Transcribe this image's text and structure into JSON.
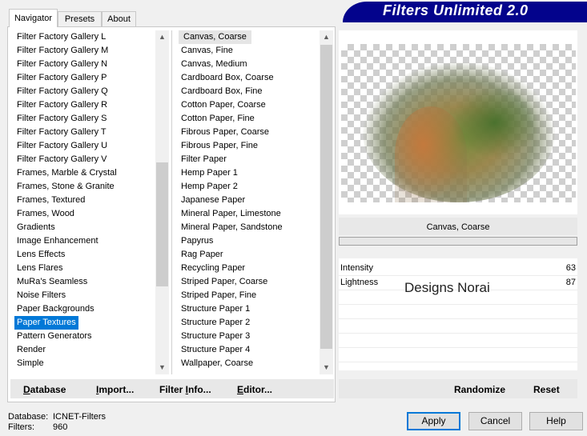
{
  "app": {
    "title": "Filters Unlimited 2.0"
  },
  "tabs": [
    {
      "label": "Navigator",
      "active": true
    },
    {
      "label": "Presets",
      "active": false
    },
    {
      "label": "About",
      "active": false
    }
  ],
  "categories": {
    "items": [
      "Filter Factory Gallery L",
      "Filter Factory Gallery M",
      "Filter Factory Gallery N",
      "Filter Factory Gallery P",
      "Filter Factory Gallery Q",
      "Filter Factory Gallery R",
      "Filter Factory Gallery S",
      "Filter Factory Gallery T",
      "Filter Factory Gallery U",
      "Filter Factory Gallery V",
      "Frames, Marble & Crystal",
      "Frames, Stone & Granite",
      "Frames, Textured",
      "Frames, Wood",
      "Gradients",
      "Image Enhancement",
      "Lens Effects",
      "Lens Flares",
      "MuRa's Seamless",
      "Noise Filters",
      "Paper Backgrounds",
      "Paper Textures",
      "Pattern Generators",
      "Render",
      "Simple"
    ],
    "selected": "Paper Textures"
  },
  "filters": {
    "items": [
      "Canvas, Coarse",
      "Canvas, Fine",
      "Canvas, Medium",
      "Cardboard Box, Coarse",
      "Cardboard Box, Fine",
      "Cotton Paper, Coarse",
      "Cotton Paper, Fine",
      "Fibrous Paper, Coarse",
      "Fibrous Paper, Fine",
      "Filter Paper",
      "Hemp Paper 1",
      "Hemp Paper 2",
      "Japanese Paper",
      "Mineral Paper, Limestone",
      "Mineral Paper, Sandstone",
      "Papyrus",
      "Rag Paper",
      "Recycling Paper",
      "Striped Paper, Coarse",
      "Striped Paper, Fine",
      "Structure Paper 1",
      "Structure Paper 2",
      "Structure Paper 3",
      "Structure Paper 4",
      "Wallpaper, Coarse"
    ],
    "selected": "Canvas, Coarse"
  },
  "left_buttons": {
    "database": {
      "u": "D",
      "rest": "atabase"
    },
    "import": {
      "u": "I",
      "rest": "mport..."
    },
    "filter_info": {
      "pre": "Filter ",
      "u": "I",
      "rest": "nfo..."
    },
    "editor": {
      "u": "E",
      "rest": "ditor..."
    }
  },
  "preview": {
    "filter_name": "Canvas, Coarse"
  },
  "params": [
    {
      "label": "Intensity",
      "value": "63"
    },
    {
      "label": "Lightness",
      "value": "87"
    }
  ],
  "watermark": "Designs Norai",
  "right_buttons": {
    "randomize": "Randomize",
    "reset": "Reset"
  },
  "status": {
    "database_label": "Database:",
    "database_value": "ICNET-Filters",
    "filters_label": "Filters:",
    "filters_value": "960"
  },
  "dialog_buttons": {
    "apply": "Apply",
    "cancel": "Cancel",
    "help": "Help"
  },
  "colors": {
    "banner": "#03038c",
    "selection": "#0078d7"
  }
}
